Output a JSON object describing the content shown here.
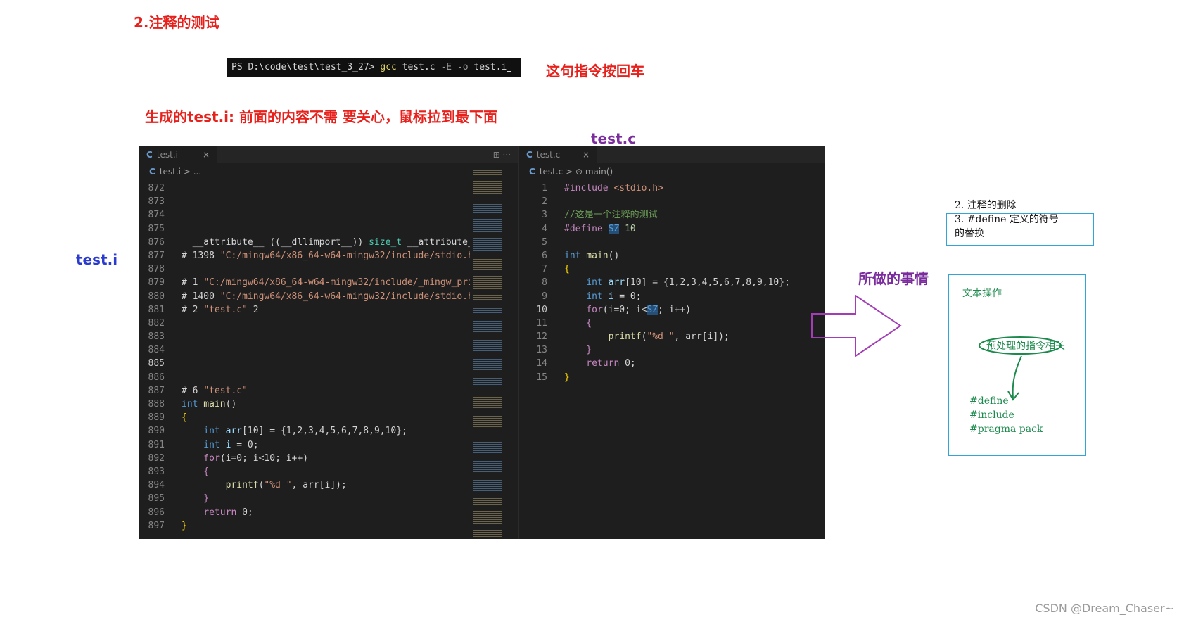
{
  "headings": {
    "section": "2.注释的测试",
    "press_enter": "这句指令按回车",
    "generated": "生成的test.i:    前面的内容不需 要关心，鼠标拉到最下面",
    "test_i_label": "test.i",
    "test_c_label": "test.c",
    "did": "所做的事情"
  },
  "terminal": {
    "prompt": "PS D:\\code\\test\\test_3_27> ",
    "cmd": "gcc",
    "arg1": " test.c ",
    "flag1": "-E",
    "flag2": " -o",
    "arg2": " test.i"
  },
  "left_pane": {
    "tab": "test.i",
    "tab_close": "×",
    "actions": "⊞  ···",
    "breadcrumb": "test.i > ...",
    "lines": {
      "n872": "872",
      "n873": "873",
      "n874": "874",
      "n875": "875",
      "n876": "876",
      "n877": "877",
      "n878": "878",
      "n879": "879",
      "n880": "880",
      "n881": "881",
      "n882": "882",
      "n883": "883",
      "n884": "884",
      "n885": "885",
      "n886": "886",
      "n887": "887",
      "n888": "888",
      "n889": "889",
      "n890": "890",
      "n891": "891",
      "n892": "892",
      "n893": "893",
      "n894": "894",
      "n895": "895",
      "n896": "896",
      "n897": "897"
    },
    "code": {
      "l876a": "  __attribute__ ((__dllimport__)) ",
      "l876b": "size_t",
      "l876c": " __attribute_",
      "l877a": "# 1398 ",
      "l877b": "\"C:/mingw64/x86_64-w64-mingw32/include/stdio.h",
      "l879a": "# 1 ",
      "l879b": "\"C:/mingw64/x86_64-w64-mingw32/include/_mingw_pri",
      "l880a": "# 1400 ",
      "l880b": "\"C:/mingw64/x86_64-w64-mingw32/include/stdio.h",
      "l881a": "# 2 ",
      "l881b": "\"test.c\"",
      "l881c": " 2",
      "l887a": "# 6 ",
      "l887b": "\"test.c\"",
      "l888a": "int",
      "l888b": " main",
      "l888c": "()",
      "l889": "{",
      "l890a": "    int",
      "l890b": " arr",
      "l890c": "[10] = {1,2,3,4,5,6,7,8,9,10};",
      "l891a": "    int",
      "l891b": " i",
      "l891c": " = 0;",
      "l892a": "    for",
      "l892b": "(i=0; i<10; i++)",
      "l893": "    {",
      "l894a": "        printf",
      "l894b": "(",
      "l894c": "\"%d \"",
      "l894d": ", arr[i]);",
      "l895": "    }",
      "l896a": "    return",
      "l896b": " 0;",
      "l897": "}"
    }
  },
  "right_pane": {
    "tab": "test.c",
    "tab_close": "×",
    "breadcrumb": "test.c > ⊙ main()",
    "lines": {
      "n1": "1",
      "n2": "2",
      "n3": "3",
      "n4": "4",
      "n5": "5",
      "n6": "6",
      "n7": "7",
      "n8": "8",
      "n9": "9",
      "n10": "10",
      "n11": "11",
      "n12": "12",
      "n13": "13",
      "n14": "14",
      "n15": "15"
    },
    "code": {
      "r1a": "#include",
      "r1b": " <stdio.h>",
      "r3": "//这是一个注释的测试",
      "r4a": "#define ",
      "r4b": "SZ",
      "r4c": " 10",
      "r6a": "int",
      "r6b": " main",
      "r6c": "()",
      "r7": "{",
      "r8a": "    int",
      "r8b": " arr",
      "r8c": "[10] = {1,2,3,4,5,6,7,8,9,10};",
      "r9a": "    int",
      "r9b": " i",
      "r9c": " = 0;",
      "r10a": "    for",
      "r10b": "(i=0; i<",
      "r10c": "SZ",
      "r10d": "; i++)",
      "r11": "    {",
      "r12a": "        printf",
      "r12b": "(",
      "r12c": "\"%d \"",
      "r12d": ", arr[i]);",
      "r13": "    }",
      "r14a": "    return",
      "r14b": " 0;",
      "r15": "}"
    }
  },
  "notes": {
    "line1": "2. 注释的删除",
    "line2": "3. #define 定义的符号",
    "line3": "的替换",
    "ops_title": "文本操作",
    "ops_related": "预处理的指令相关",
    "define": "#define",
    "include": "#include",
    "pragma": "#pragma pack"
  },
  "watermark": "CSDN @Dream_Chaser~",
  "colors": {
    "heading_red": "#e8201b",
    "label_blue": "#2b3bcf",
    "label_purple": "#7b2d9e",
    "note_green": "#1d8a4d",
    "box_blue": "#33a4d8"
  }
}
